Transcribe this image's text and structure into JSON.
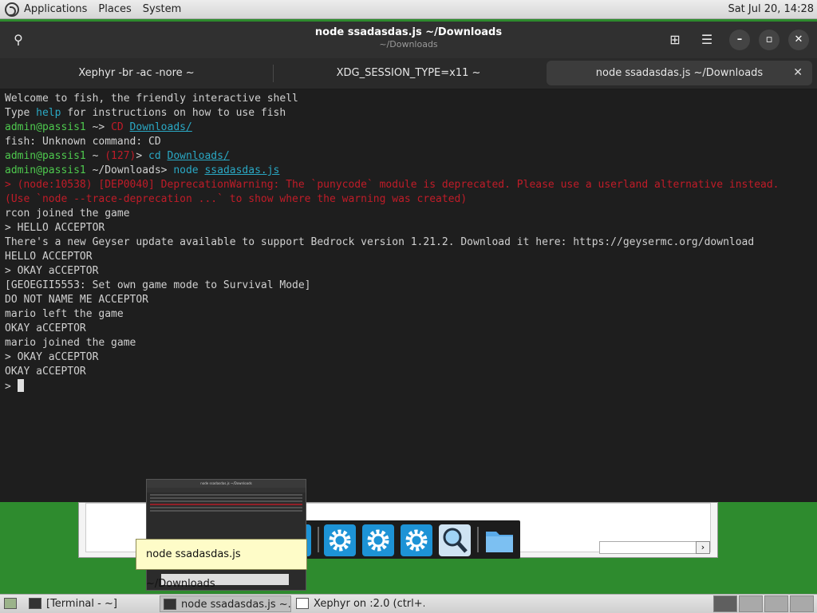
{
  "top_panel": {
    "menus": [
      "Applications",
      "Places",
      "System"
    ],
    "clock": "Sat Jul 20, 14:28"
  },
  "terminal": {
    "title": "node ssadasdas.js ~/Downloads",
    "subtitle": "~/Downloads",
    "tabs": [
      {
        "label": "Xephyr -br -ac -nore ~"
      },
      {
        "label": "XDG_SESSION_TYPE=x11 ~"
      },
      {
        "label": "node ssadasdas.js ~/Downloads",
        "close": "✕"
      }
    ],
    "icons": {
      "search": "⚲",
      "new_tab": "⊞",
      "menu": "☰",
      "minimize": "–",
      "maximize": "▫",
      "close": "✕"
    },
    "lines": {
      "l1": "Welcome to fish, the friendly interactive shell",
      "l2a": "Type ",
      "l2b": "help",
      "l2c": " for instructions on how to use fish",
      "l3_user": "admin@passis1",
      "l3_path": " ~> ",
      "l3_cmd": "CD",
      "l3_arg": "Downloads/",
      "l4": "fish: Unknown command: CD",
      "l5_user": "admin@passis1",
      "l5_path": " ~ ",
      "l5_status": "(127)",
      "l5_gt": "> ",
      "l5_cmd": "cd",
      "l5_arg": "Downloads/",
      "l6_user": "admin@passis1",
      "l6_path": " ~/Downloads> ",
      "l6_cmd": "node",
      "l6_arg": "ssadasdas.js",
      "l7": "> (node:10538) [DEP0040] DeprecationWarning: The `punycode` module is deprecated. Please use a userland alternative instead.",
      "l8": "(Use `node --trace-deprecation ...` to show where the warning was created)",
      "l9": "rcon joined the game",
      "l10": "> HELLO ACCEPTOR",
      "l11": "There's a new Geyser update available to support Bedrock version 1.21.2. Download it here: https://geysermc.org/download",
      "l12": "HELLO ACCEPTOR",
      "l13": "> OKAY aCCEPTOR",
      "l14": "[GEOEGII5553: Set own game mode to Survival Mode]",
      "l15": "DO NOT NAME ME ACCEPTOR",
      "l16": "mario left the game",
      "l17": "OKAY aCCEPTOR",
      "l18": "mario joined the game",
      "l19": "> OKAY aCCEPTOR",
      "l20": "OKAY aCCEPTOR",
      "l21": "> "
    }
  },
  "preview": {
    "title": "node ssadasdas.js ~/Downloads"
  },
  "tooltip": "node ssadasdas.js ~/Downloads",
  "dock": {
    "items": [
      "gear-icon",
      "gear-icon",
      "gear-icon",
      "magnifier-icon",
      "folder-icon"
    ]
  },
  "bg_window": {
    "arrow": "›"
  },
  "taskbar": {
    "tasks": [
      {
        "label": "[Terminal - ~]"
      },
      {
        "label": "node ssadasdas.js ~..."
      },
      {
        "label": "Xephyr on :2.0 (ctrl+..."
      }
    ]
  }
}
